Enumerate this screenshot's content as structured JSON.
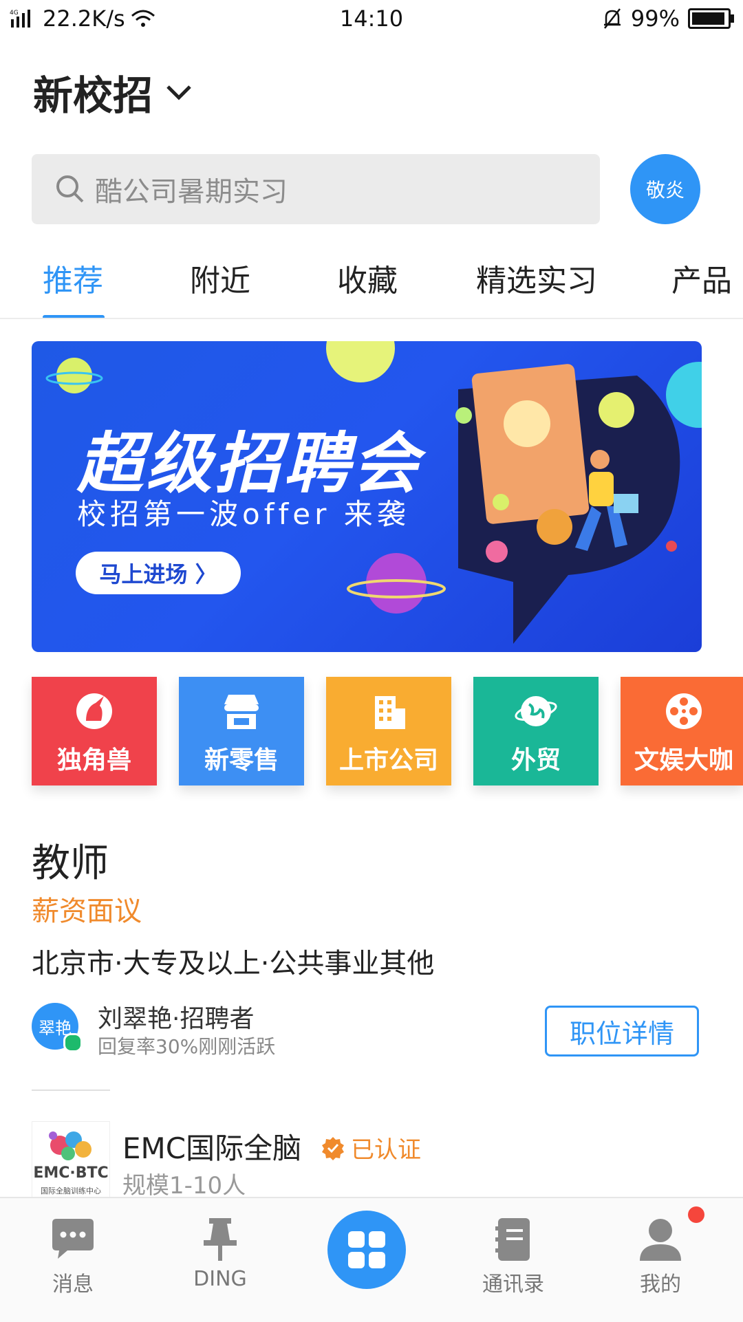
{
  "status_bar": {
    "network": "4G",
    "speed": "22.2K/s",
    "time": "14:10",
    "battery": "99%"
  },
  "header": {
    "org_name": "新校招",
    "search_placeholder": "酷公司暑期实习",
    "avatar_text": "敬炎"
  },
  "tabs": [
    {
      "label": "推荐",
      "active": true
    },
    {
      "label": "附近",
      "active": false
    },
    {
      "label": "收藏",
      "active": false
    },
    {
      "label": "精选实习",
      "active": false
    },
    {
      "label": "产品",
      "active": false
    }
  ],
  "banner": {
    "title": "超级招聘会",
    "subtitle": "校招第一波offer 来袭",
    "cta": "马上进场 〉"
  },
  "categories": [
    {
      "label": "独角兽",
      "color": "#f0424b",
      "icon": "unicorn-icon"
    },
    {
      "label": "新零售",
      "color": "#3d8ff3",
      "icon": "store-icon"
    },
    {
      "label": "上市公司",
      "color": "#f9ac31",
      "icon": "building-icon"
    },
    {
      "label": "外贸",
      "color": "#1ab797",
      "icon": "globe-icon"
    },
    {
      "label": "文娱大咖",
      "color": "#fa6b35",
      "icon": "film-reel-icon"
    }
  ],
  "job": {
    "title": "教师",
    "salary": "薪资面议",
    "meta": "北京市·大专及以上·公共事业其他",
    "recruiter_avatar": "翠艳",
    "recruiter_name": "刘翠艳·招聘者",
    "recruiter_status": "回复率30%刚刚活跃",
    "detail_button": "职位详情"
  },
  "company": {
    "logo_text": "EMC·BTC",
    "logo_subtext": "国际全脑训练中心",
    "name": "EMC国际全脑",
    "verified": "已认证",
    "size": "规模1-10人"
  },
  "bottom_nav": [
    {
      "label": "消息",
      "icon": "message-icon"
    },
    {
      "label": "DING",
      "icon": "pin-icon"
    },
    {
      "label": "",
      "icon": "apps-grid-icon"
    },
    {
      "label": "通讯录",
      "icon": "contacts-icon"
    },
    {
      "label": "我的",
      "icon": "profile-icon"
    }
  ],
  "colors": {
    "accent": "#2f95f6",
    "salary": "#f08a2c",
    "badge": "#f5463c"
  }
}
